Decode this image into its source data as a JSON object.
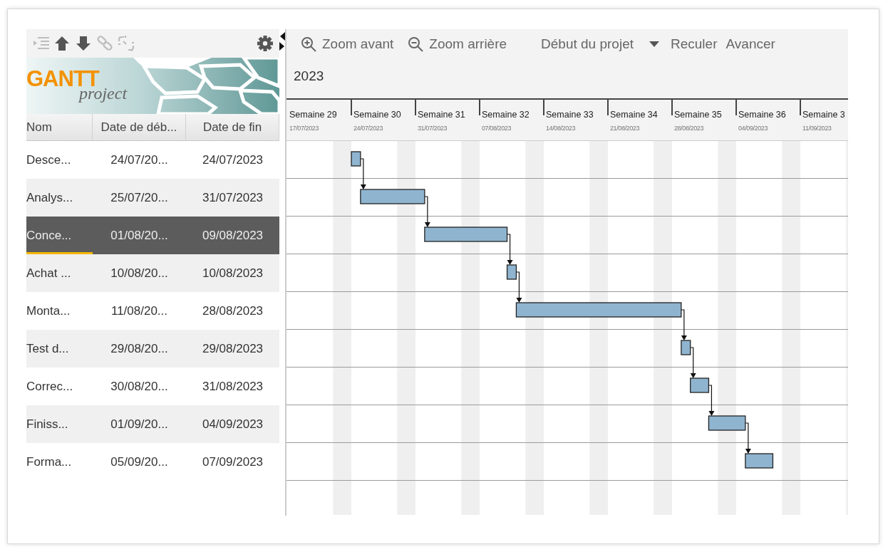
{
  "task_toolbar": {
    "buttons": [
      {
        "kind": "indent",
        "disabled": true
      },
      {
        "kind": "up",
        "disabled": false
      },
      {
        "kind": "down",
        "disabled": false
      },
      {
        "kind": "link",
        "disabled": true
      },
      {
        "kind": "unlink",
        "disabled": true
      },
      {
        "kind": "settings",
        "disabled": false
      }
    ]
  },
  "logo": {
    "word": "GANTT",
    "subtitle": "project"
  },
  "table": {
    "columns": [
      "Nom",
      "Date de déb...",
      "Date de fin"
    ],
    "rows": [
      {
        "name": "Desce...",
        "start": "24/07/20...",
        "end": "24/07/2023",
        "selected": false,
        "links_to_next": true
      },
      {
        "name": "Analys...",
        "start": "25/07/20...",
        "end": "31/07/2023",
        "selected": false,
        "links_to_next": true
      },
      {
        "name": "Conce...",
        "start": "01/08/20...",
        "end": "09/08/2023",
        "selected": true,
        "links_to_next": true
      },
      {
        "name": "Achat ...",
        "start": "10/08/20...",
        "end": "10/08/2023",
        "selected": false,
        "links_to_next": true
      },
      {
        "name": "Monta...",
        "start": "11/08/20...",
        "end": "28/08/2023",
        "selected": false,
        "links_to_next": true
      },
      {
        "name": "Test d...",
        "start": "29/08/20...",
        "end": "29/08/2023",
        "selected": false,
        "links_to_next": true
      },
      {
        "name": "Correc...",
        "start": "30/08/20...",
        "end": "31/08/2023",
        "selected": false,
        "links_to_next": true
      },
      {
        "name": "Finiss...",
        "start": "01/09/20...",
        "end": "04/09/2023",
        "selected": false,
        "links_to_next": true
      },
      {
        "name": "Forma...",
        "start": "05/09/20...",
        "end": "07/09/2023",
        "selected": false,
        "links_to_next": false
      }
    ]
  },
  "chart_toolbar": {
    "zoom_in": "Zoom avant",
    "zoom_out": "Zoom arrière",
    "view_select": "Début du projet",
    "back": "Reculer",
    "forward": "Avancer"
  },
  "timeline": {
    "year": "2023",
    "weeks": [
      {
        "label": "Semaine 29",
        "date": "17/07/2023"
      },
      {
        "label": "Semaine 30",
        "date": "24/07/2023"
      },
      {
        "label": "Semaine 31",
        "date": "31/07/2023"
      },
      {
        "label": "Semaine 32",
        "date": "07/08/2023"
      },
      {
        "label": "Semaine 33",
        "date": "14/08/2023"
      },
      {
        "label": "Semaine 34",
        "date": "21/08/2023"
      },
      {
        "label": "Semaine 35",
        "date": "28/08/2023"
      },
      {
        "label": "Semaine 36",
        "date": "04/09/2023"
      },
      {
        "label": "Semaine 3",
        "date": "11/09/2023"
      }
    ]
  }
}
